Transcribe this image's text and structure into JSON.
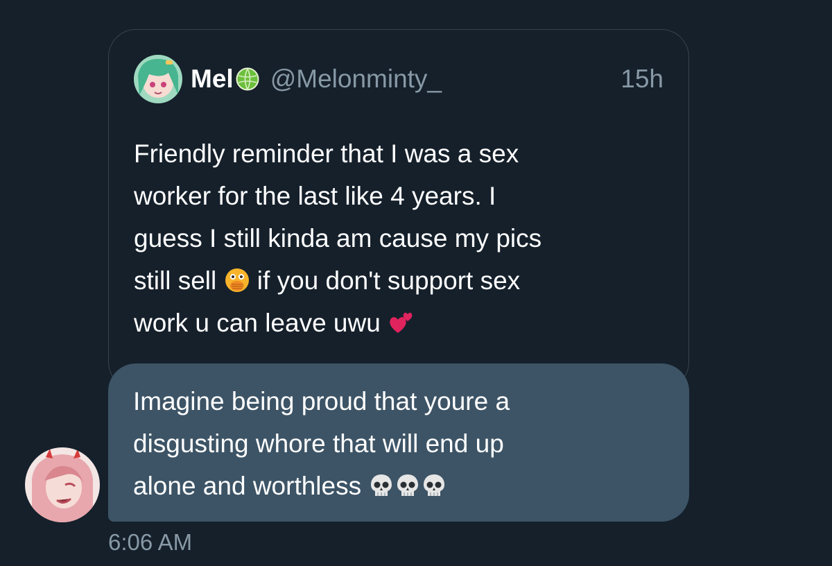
{
  "quoted_tweet": {
    "display_name": "Mel",
    "handle": "@Melonminty_",
    "time": "15h",
    "text_parts": [
      "Friendly reminder that I was a sex\nworker for the last like 4 years. I\nguess I still kinda am cause my pics\nstill sell ",
      " if you don't support sex\nwork u can leave uwu "
    ],
    "avatar_icon": "anime-avatar-green-hair-icon",
    "badge_icon": "melon-icon",
    "emojis": [
      "face-with-open-eyes-and-hand-over-mouth-emoji",
      "two-hearts-emoji"
    ]
  },
  "message": {
    "text": "Imagine being proud that youre a\ndisgusting whore that will end up\nalone and worthless ",
    "emojis": [
      "skull-emoji",
      "skull-emoji",
      "skull-emoji"
    ],
    "sender_avatar_icon": "anime-avatar-pink-hair-icon",
    "timestamp": "6:06 AM"
  },
  "colors": {
    "background": "#15202b",
    "bubble": "#3d5466",
    "card_border": "#38444d",
    "secondary_text": "#8899a6"
  }
}
